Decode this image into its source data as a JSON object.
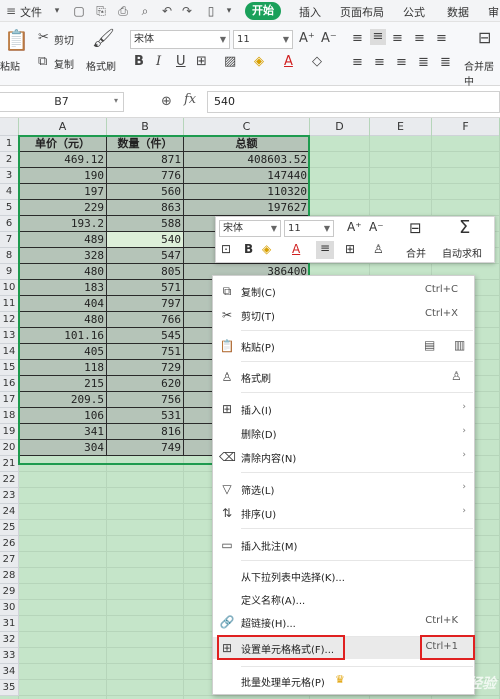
{
  "topbar": {
    "file_label": "文件",
    "tabs": [
      "开始",
      "插入",
      "页面布局",
      "公式",
      "数据",
      "审"
    ]
  },
  "ribbon": {
    "paste_label": "粘贴",
    "cut_label": "剪切",
    "copy_label": "复制",
    "format_painter_label": "格式刷",
    "font_name": "宋体",
    "font_size": "11",
    "merge_label": "合并居中"
  },
  "formula_bar": {
    "cell_ref": "B7",
    "fx_label": "fx",
    "value": "540"
  },
  "sheet": {
    "columns": [
      "A",
      "B",
      "C",
      "D",
      "E",
      "F"
    ],
    "headers": [
      "单价（元）",
      "数量（件）",
      "总额"
    ],
    "rows": [
      [
        "469.12",
        "871",
        "408603.52"
      ],
      [
        "190",
        "776",
        "147440"
      ],
      [
        "197",
        "560",
        "110320"
      ],
      [
        "229",
        "863",
        "197627"
      ],
      [
        "193.2",
        "588",
        ""
      ],
      [
        "489",
        "540",
        ""
      ],
      [
        "328",
        "547",
        ""
      ],
      [
        "480",
        "805",
        "386400"
      ],
      [
        "183",
        "571",
        ""
      ],
      [
        "404",
        "797",
        ""
      ],
      [
        "480",
        "766",
        ""
      ],
      [
        "101.16",
        "545",
        ""
      ],
      [
        "405",
        "751",
        ""
      ],
      [
        "118",
        "729",
        ""
      ],
      [
        "215",
        "620",
        ""
      ],
      [
        "209.5",
        "756",
        ""
      ],
      [
        "106",
        "531",
        ""
      ],
      [
        "341",
        "816",
        ""
      ],
      [
        "304",
        "749",
        ""
      ]
    ],
    "row_numbers": [
      "1",
      "2",
      "3",
      "4",
      "5",
      "6",
      "7",
      "8",
      "9",
      "10",
      "11",
      "12",
      "13",
      "14",
      "15",
      "16",
      "17",
      "18",
      "19",
      "20",
      "21",
      "22",
      "23",
      "24",
      "25",
      "26",
      "27",
      "28",
      "29",
      "30",
      "31",
      "32",
      "33",
      "34",
      "35"
    ]
  },
  "mini_toolbar": {
    "font_name": "宋体",
    "font_size": "11",
    "merge_label": "合并",
    "autosum_label": "自动求和"
  },
  "context_menu": {
    "items": [
      {
        "label": "复制(C)",
        "shortcut": "Ctrl+C"
      },
      {
        "label": "剪切(T)",
        "shortcut": "Ctrl+X"
      },
      {
        "label": "粘贴(P)",
        "shortcut": ""
      },
      {
        "label": "格式刷",
        "shortcut": ""
      },
      {
        "label": "插入(I)",
        "shortcut": ""
      },
      {
        "label": "删除(D)",
        "shortcut": ""
      },
      {
        "label": "清除内容(N)",
        "shortcut": ""
      },
      {
        "label": "筛选(L)",
        "shortcut": ""
      },
      {
        "label": "排序(U)",
        "shortcut": ""
      },
      {
        "label": "插入批注(M)",
        "shortcut": ""
      },
      {
        "label": "从下拉列表中选择(K)...",
        "shortcut": ""
      },
      {
        "label": "定义名称(A)...",
        "shortcut": ""
      },
      {
        "label": "超链接(H)...",
        "shortcut": "Ctrl+K"
      },
      {
        "label": "设置单元格格式(F)...",
        "shortcut": "Ctrl+1"
      },
      {
        "label": "批量处理单元格(P)",
        "shortcut": ""
      }
    ]
  },
  "watermark": "Bai 经验",
  "colors": {
    "accent": "#1aa05a",
    "grid_bg": "#c5e5c9",
    "highlight": "#e02020"
  }
}
